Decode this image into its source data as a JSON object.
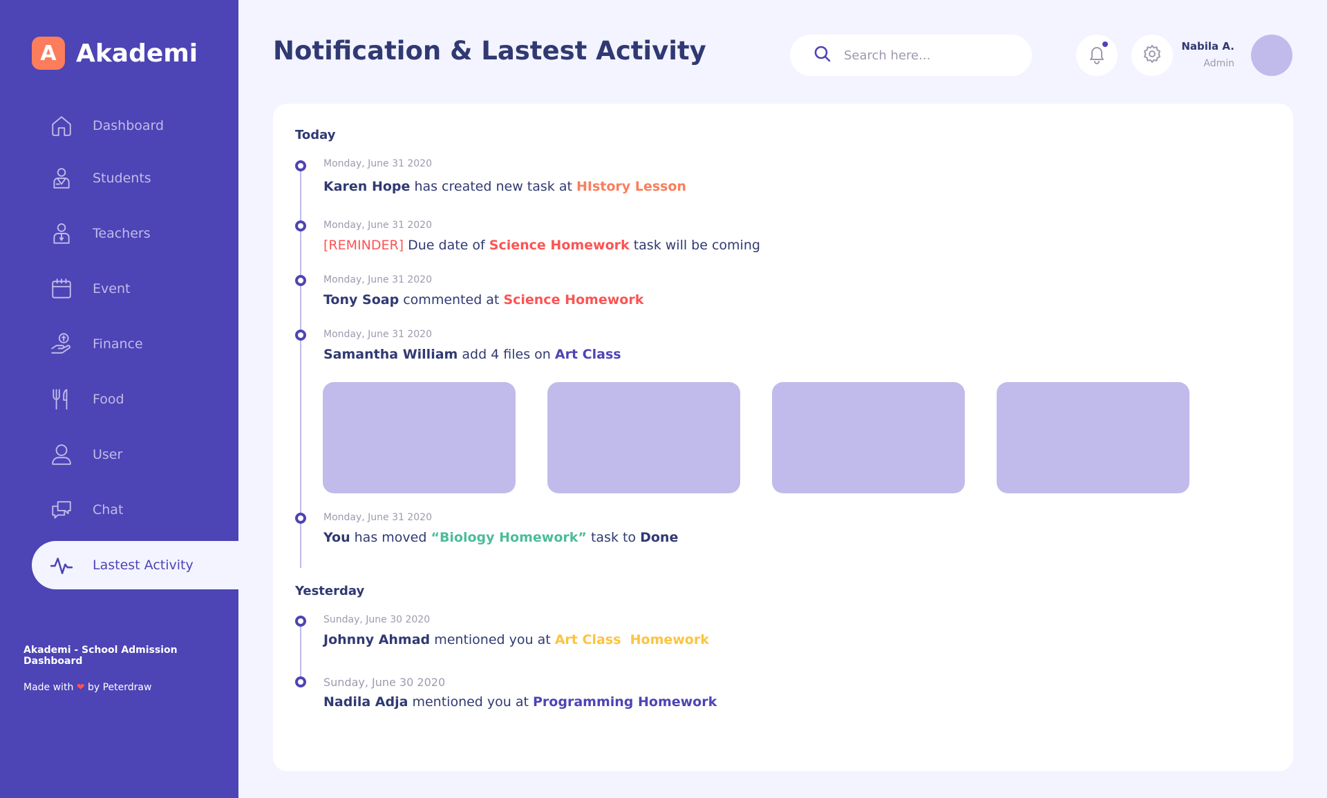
{
  "app": {
    "logo_letter": "A",
    "name": "Akademi"
  },
  "sidebar": {
    "items": [
      {
        "label": "Dashboard",
        "icon": "home-icon"
      },
      {
        "label": "Students",
        "icon": "student-icon"
      },
      {
        "label": "Teachers",
        "icon": "teacher-icon"
      },
      {
        "label": "Event",
        "icon": "calendar-icon"
      },
      {
        "label": "Finance",
        "icon": "finance-icon"
      },
      {
        "label": "Food",
        "icon": "food-icon"
      },
      {
        "label": "User",
        "icon": "user-icon"
      },
      {
        "label": "Chat",
        "icon": "chat-icon"
      },
      {
        "label": "Lastest Activity",
        "icon": "activity-icon",
        "active": true
      }
    ],
    "footer_title": "Akademi - School Admission Dashboard",
    "footer_made_prefix": "Made with",
    "footer_heart": "❤",
    "footer_made_suffix": "by Peterdraw"
  },
  "header": {
    "title": "Notification & Lastest Activity",
    "search_placeholder": "Search here...",
    "user_name": "Nabila A.",
    "user_role": "Admin"
  },
  "activity": {
    "today_label": "Today",
    "yesterday_label": "Yesterday",
    "today": [
      {
        "date": "Monday, June 31 2020",
        "actor": "Karen Hope",
        "text": "has created new task at",
        "target": "HIstory Lesson"
      },
      {
        "date": "Monday, June 31 2020",
        "tag": "[REMINDER]",
        "text": "Due date of",
        "target": "Science Homework",
        "text2": "task will be coming"
      },
      {
        "date": "Monday, June 31 2020",
        "actor": "Tony Soap",
        "text": "commented at",
        "target": "Science Homework"
      },
      {
        "date": "Monday, June 31 2020",
        "actor": "Samantha William",
        "text": "add 4 files on",
        "target": "Art Class"
      },
      {
        "date": "Monday, June 31 2020",
        "actor": "You",
        "text": "has moved",
        "target": "“Biology Homework”",
        "text2": "task to",
        "status": "Done"
      }
    ],
    "yesterday": [
      {
        "date": "Sunday, June 30 2020",
        "actor": "Johnny Ahmad",
        "text": "mentioned you at",
        "target": "Art Class  Homework"
      },
      {
        "date": "Sunday, June 30 2020",
        "actor": "Nadila Adja",
        "text": "mentioned you at",
        "target": "Programming Homework"
      }
    ],
    "file_count": 4
  },
  "colors": {
    "brand": "#4D44B5",
    "accent_orange": "#FB7D5B",
    "accent_red": "#FD5353",
    "accent_green": "#4CBC9A",
    "accent_yellow": "#FCC43E",
    "placeholder_lilac": "#C1BBEB"
  }
}
